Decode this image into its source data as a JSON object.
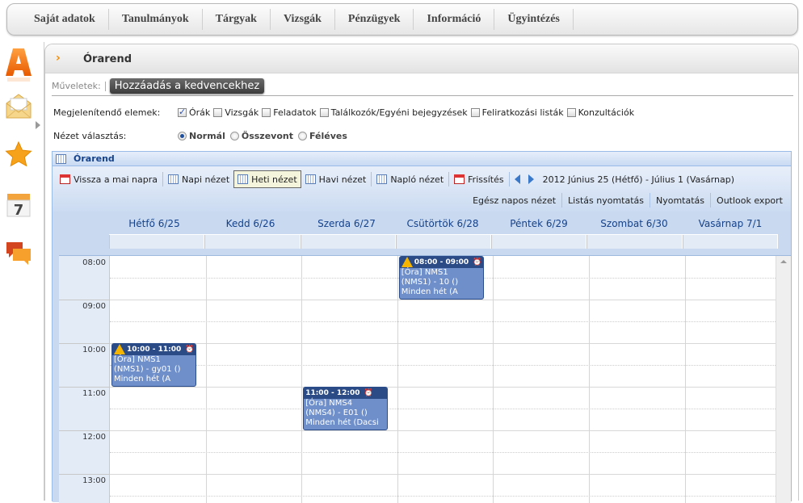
{
  "topnav": {
    "items": [
      "Saját adatok",
      "Tanulmányok",
      "Tárgyak",
      "Vizsgák",
      "Pénzügyek",
      "Információ",
      "Ügyintézés"
    ]
  },
  "sidebar": {
    "icons": [
      "app-logo-icon",
      "mail-icon",
      "favorites-star-icon",
      "calendar-icon",
      "chat-icon"
    ],
    "calendar_number": "7"
  },
  "panel": {
    "title": "Órarend",
    "ops_label": "Műveletek:",
    "fav_button": "Hozzáadás a kedvencekhez"
  },
  "filters": {
    "label": "Megjelenítendő elemek:",
    "options": [
      {
        "label": "Órák",
        "checked": true
      },
      {
        "label": "Vizsgák",
        "checked": false
      },
      {
        "label": "Feladatok",
        "checked": false
      },
      {
        "label": "Találkozók/Egyéni bejegyzések",
        "checked": false
      },
      {
        "label": "Feliratkozási listák",
        "checked": false
      },
      {
        "label": "Konzultációk",
        "checked": false
      }
    ]
  },
  "view": {
    "label": "Nézet választás:",
    "options": [
      {
        "label": "Normál",
        "selected": true
      },
      {
        "label": "Összevont",
        "selected": false
      },
      {
        "label": "Féléves",
        "selected": false
      }
    ]
  },
  "calendar": {
    "title": "Órarend",
    "toolbar": {
      "today": "Vissza a mai napra",
      "day": "Napi nézet",
      "week": "Heti nézet",
      "month": "Havi nézet",
      "log": "Napló nézet",
      "refresh": "Frissítés",
      "range": "2012 Június 25 (Hétfő) - Július 1 (Vasárnap)",
      "allday": "Egész napos nézet",
      "listprint": "Listás nyomtatás",
      "print": "Nyomtatás",
      "outlook": "Outlook export"
    },
    "days": [
      "Hétfő 6/25",
      "Kedd 6/26",
      "Szerda 6/27",
      "Csütörtök 6/28",
      "Péntek 6/29",
      "Szombat 6/30",
      "Vasárnap 7/1"
    ],
    "hours": [
      "08:00",
      "09:00",
      "10:00",
      "11:00",
      "12:00",
      "13:00"
    ],
    "events": [
      {
        "day": 3,
        "time": "08:00 - 09:00",
        "warning": true,
        "line1": "[Óra] NMS1",
        "line2": "(NMS1) - 10 ()",
        "line3": "Minden hét (A"
      },
      {
        "day": 0,
        "time": "10:00 - 11:00",
        "warning": true,
        "line1": "[Óra] NMS1",
        "line2": "(NMS1) - gy01 ()",
        "line3": "Minden hét (A"
      },
      {
        "day": 2,
        "time": "11:00 - 12:00",
        "warning": false,
        "line1": "[Óra] NMS4",
        "line2": "(NMS4) - E01 ()",
        "line3": "Minden hét (Dacsi"
      }
    ],
    "colors": {
      "event_bg": "#6f8fcb",
      "event_header": "#2b4b87",
      "day_header_text": "#15428b"
    }
  }
}
